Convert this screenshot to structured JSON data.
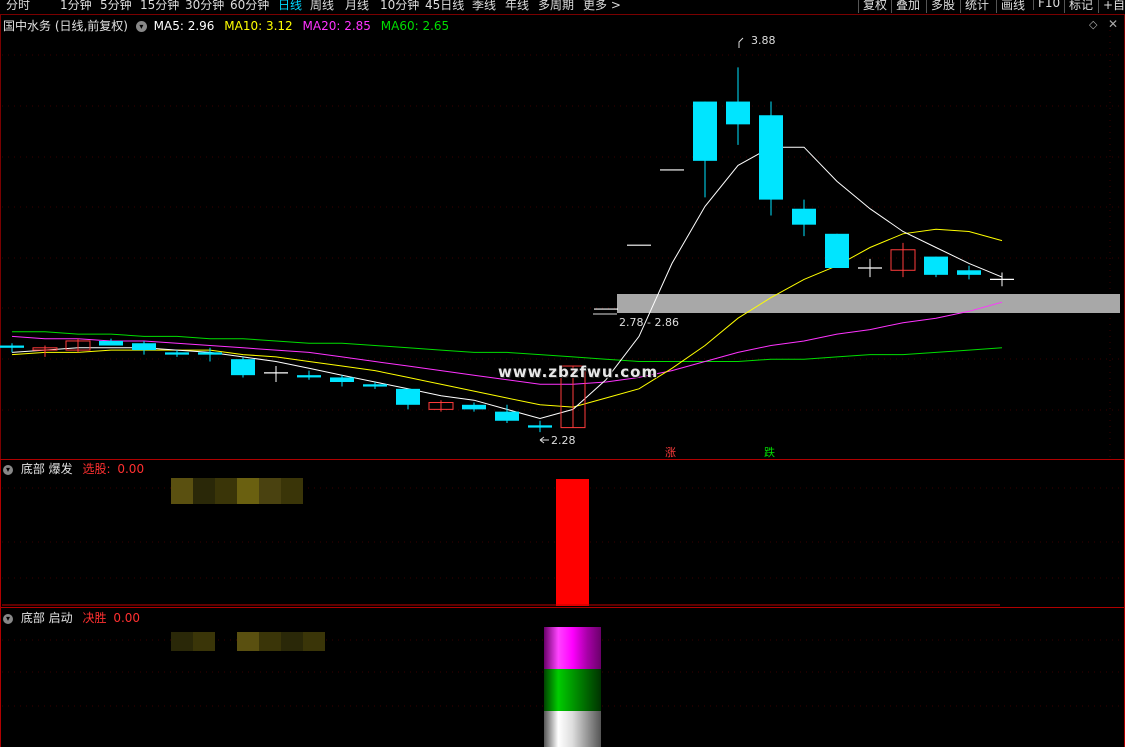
{
  "toolbar": {
    "periods": [
      "分时",
      "1分钟",
      "5分钟",
      "15分钟",
      "30分钟",
      "60分钟",
      "日线",
      "周线",
      "月线",
      "10分钟",
      "45日线",
      "季线",
      "年线",
      "多周期",
      "更多 >"
    ],
    "active_period": "日线",
    "right_buttons": [
      "复权",
      "叠加",
      "多股",
      "统计",
      "画线",
      "F10",
      "标记",
      "+自选"
    ]
  },
  "main_chart": {
    "title": "国中水务 (日线,前复权)",
    "ma5_label": "MA5: 2.96",
    "ma10_label": "MA10: 3.12",
    "ma20_label": "MA20: 2.85",
    "ma60_label": "MA60: 2.65",
    "high_label": "3.88",
    "low_label": "2.28",
    "zone_label": "2.78 - 2.86",
    "up_marker": "涨",
    "down_marker": "跌",
    "watermark": "www.zbzfwu.com",
    "colors": {
      "up": "#ff3c3c",
      "down": "#00e5ff",
      "ma5": "#ffffff",
      "ma10": "#ffff00",
      "ma20": "#ff33ff",
      "ma60": "#00dd00"
    }
  },
  "chart_data": {
    "type": "candlestick",
    "ylim": [
      2.2,
      4.0
    ],
    "candles": [
      {
        "o": 2.66,
        "h": 2.67,
        "l": 2.63,
        "c": 2.65
      },
      {
        "o": 2.64,
        "h": 2.66,
        "l": 2.61,
        "c": 2.65
      },
      {
        "o": 2.64,
        "h": 2.69,
        "l": 2.63,
        "c": 2.68
      },
      {
        "o": 2.68,
        "h": 2.69,
        "l": 2.66,
        "c": 2.66
      },
      {
        "o": 2.67,
        "h": 2.68,
        "l": 2.62,
        "c": 2.64
      },
      {
        "o": 2.63,
        "h": 2.64,
        "l": 2.61,
        "c": 2.62
      },
      {
        "o": 2.63,
        "h": 2.65,
        "l": 2.59,
        "c": 2.62
      },
      {
        "o": 2.6,
        "h": 2.61,
        "l": 2.52,
        "c": 2.53
      },
      {
        "o": 2.54,
        "h": 2.57,
        "l": 2.5,
        "c": 2.54
      },
      {
        "o": 2.53,
        "h": 2.55,
        "l": 2.51,
        "c": 2.52
      },
      {
        "o": 2.52,
        "h": 2.53,
        "l": 2.48,
        "c": 2.5
      },
      {
        "o": 2.49,
        "h": 2.5,
        "l": 2.47,
        "c": 2.48
      },
      {
        "o": 2.47,
        "h": 2.47,
        "l": 2.38,
        "c": 2.4
      },
      {
        "o": 2.38,
        "h": 2.42,
        "l": 2.37,
        "c": 2.41
      },
      {
        "o": 2.4,
        "h": 2.41,
        "l": 2.37,
        "c": 2.38
      },
      {
        "o": 2.37,
        "h": 2.4,
        "l": 2.32,
        "c": 2.33
      },
      {
        "o": 2.31,
        "h": 2.33,
        "l": 2.28,
        "c": 2.3
      },
      {
        "o": 2.3,
        "h": 2.57,
        "l": 2.3,
        "c": 2.57
      },
      {
        "o": 2.82,
        "h": 2.82,
        "l": 2.82,
        "c": 2.82
      },
      {
        "o": 3.1,
        "h": 3.1,
        "l": 3.1,
        "c": 3.1
      },
      {
        "o": 3.43,
        "h": 3.43,
        "l": 3.43,
        "c": 3.43
      },
      {
        "o": 3.73,
        "h": 3.73,
        "l": 3.31,
        "c": 3.47
      },
      {
        "o": 3.73,
        "h": 3.88,
        "l": 3.54,
        "c": 3.63
      },
      {
        "o": 3.67,
        "h": 3.73,
        "l": 3.23,
        "c": 3.3
      },
      {
        "o": 3.26,
        "h": 3.3,
        "l": 3.14,
        "c": 3.19
      },
      {
        "o": 3.15,
        "h": 3.15,
        "l": 3.0,
        "c": 3.0
      },
      {
        "o": 3.0,
        "h": 3.04,
        "l": 2.96,
        "c": 3.0
      },
      {
        "o": 2.99,
        "h": 3.11,
        "l": 2.96,
        "c": 3.08
      },
      {
        "o": 3.05,
        "h": 3.05,
        "l": 2.96,
        "c": 2.97
      },
      {
        "o": 2.99,
        "h": 3.01,
        "l": 2.95,
        "c": 2.97
      },
      {
        "o": 2.95,
        "h": 2.98,
        "l": 2.92,
        "c": 2.95
      }
    ],
    "ma5": [
      2.63,
      2.64,
      2.65,
      2.65,
      2.65,
      2.64,
      2.63,
      2.61,
      2.59,
      2.56,
      2.53,
      2.5,
      2.47,
      2.44,
      2.42,
      2.38,
      2.34,
      2.38,
      2.51,
      2.7,
      3.02,
      3.27,
      3.45,
      3.53,
      3.53,
      3.38,
      3.26,
      3.16,
      3.09,
      3.02,
      2.96
    ],
    "ma10": [
      2.62,
      2.63,
      2.63,
      2.64,
      2.64,
      2.64,
      2.64,
      2.62,
      2.61,
      2.59,
      2.57,
      2.55,
      2.52,
      2.49,
      2.46,
      2.43,
      2.4,
      2.39,
      2.43,
      2.47,
      2.56,
      2.66,
      2.78,
      2.87,
      2.95,
      3.01,
      3.09,
      3.15,
      3.17,
      3.16,
      3.12
    ],
    "ma20": [
      2.7,
      2.69,
      2.69,
      2.68,
      2.68,
      2.67,
      2.66,
      2.65,
      2.64,
      2.63,
      2.61,
      2.59,
      2.57,
      2.55,
      2.53,
      2.51,
      2.49,
      2.49,
      2.5,
      2.52,
      2.55,
      2.59,
      2.63,
      2.66,
      2.68,
      2.71,
      2.73,
      2.76,
      2.78,
      2.81,
      2.85
    ],
    "ma60": [
      2.72,
      2.72,
      2.71,
      2.71,
      2.7,
      2.7,
      2.69,
      2.69,
      2.68,
      2.67,
      2.67,
      2.66,
      2.65,
      2.64,
      2.63,
      2.63,
      2.62,
      2.61,
      2.6,
      2.59,
      2.59,
      2.59,
      2.59,
      2.6,
      2.6,
      2.61,
      2.62,
      2.62,
      2.63,
      2.64,
      2.65
    ]
  },
  "panel1": {
    "title": "底部 爆发",
    "label": "选股:",
    "value": "0.00"
  },
  "panel2": {
    "title": "底部 启动",
    "label": "决胜",
    "value": "0.00"
  }
}
